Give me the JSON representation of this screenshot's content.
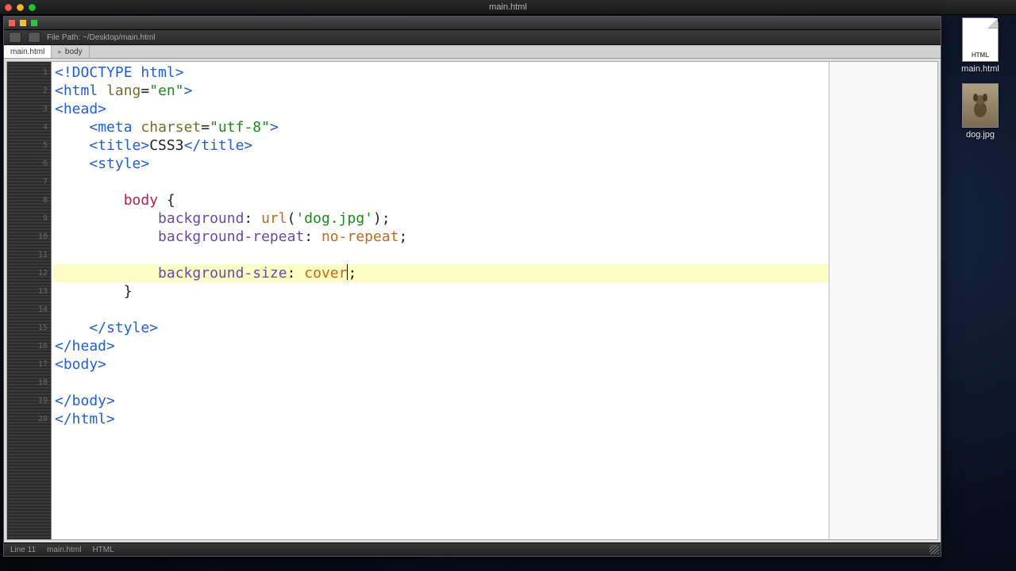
{
  "menubar": {
    "center_title": "main.html"
  },
  "desktop": {
    "file1": {
      "badge": "HTML",
      "label": "main.html"
    },
    "file2": {
      "label": "dog.jpg"
    }
  },
  "window": {
    "title_path": "File Path: ~/Desktop/main.html",
    "tab_label": "main.html",
    "breadcrumb": "body"
  },
  "statusbar": {
    "left": "Line 11",
    "mid": "main.html",
    "right": "HTML"
  },
  "code": {
    "lines": [
      {
        "indent": 0,
        "tokens": [
          {
            "cls": "tag",
            "t": "<!DOCTYPE html>"
          }
        ]
      },
      {
        "indent": 0,
        "tokens": [
          {
            "cls": "tag",
            "t": "<html "
          },
          {
            "cls": "attr",
            "t": "lang"
          },
          {
            "cls": "punc",
            "t": "="
          },
          {
            "cls": "str",
            "t": "\"en\""
          },
          {
            "cls": "tag",
            "t": ">"
          }
        ]
      },
      {
        "indent": 0,
        "tokens": [
          {
            "cls": "tag",
            "t": "<head>"
          }
        ]
      },
      {
        "indent": 1,
        "tokens": [
          {
            "cls": "tag",
            "t": "<meta "
          },
          {
            "cls": "attr",
            "t": "charset"
          },
          {
            "cls": "punc",
            "t": "="
          },
          {
            "cls": "str",
            "t": "\"utf-8\""
          },
          {
            "cls": "tag",
            "t": ">"
          }
        ]
      },
      {
        "indent": 1,
        "tokens": [
          {
            "cls": "tag",
            "t": "<title>"
          },
          {
            "cls": "punc",
            "t": "CSS3"
          },
          {
            "cls": "tag",
            "t": "</title>"
          }
        ]
      },
      {
        "indent": 1,
        "tokens": [
          {
            "cls": "tag",
            "t": "<style>"
          }
        ]
      },
      {
        "blank": true
      },
      {
        "indent": 2,
        "tokens": [
          {
            "cls": "sel",
            "t": "body"
          },
          {
            "cls": "punc",
            "t": " {"
          }
        ]
      },
      {
        "indent": 3,
        "tokens": [
          {
            "cls": "prop",
            "t": "background"
          },
          {
            "cls": "punc",
            "t": ": "
          },
          {
            "cls": "val",
            "t": "url"
          },
          {
            "cls": "punc",
            "t": "("
          },
          {
            "cls": "str",
            "t": "'dog.jpg'"
          },
          {
            "cls": "punc",
            "t": ");"
          }
        ]
      },
      {
        "indent": 3,
        "tokens": [
          {
            "cls": "prop",
            "t": "background-repeat"
          },
          {
            "cls": "punc",
            "t": ": "
          },
          {
            "cls": "val",
            "t": "no-repeat"
          },
          {
            "cls": "punc",
            "t": ";"
          }
        ]
      },
      {
        "blank": true
      },
      {
        "hl": true,
        "caret_after": 4,
        "indent": 3,
        "tokens": [
          {
            "cls": "prop",
            "t": "background-size"
          },
          {
            "cls": "punc",
            "t": ": "
          },
          {
            "cls": "val",
            "t": "cover"
          },
          {
            "cls": "punc",
            "t": ";"
          }
        ]
      },
      {
        "indent": 2,
        "tokens": [
          {
            "cls": "punc",
            "t": "}"
          }
        ]
      },
      {
        "blank": true
      },
      {
        "indent": 1,
        "tokens": [
          {
            "cls": "tag",
            "t": "</style>"
          }
        ]
      },
      {
        "indent": 0,
        "tokens": [
          {
            "cls": "tag",
            "t": "</head>"
          }
        ]
      },
      {
        "indent": 0,
        "tokens": [
          {
            "cls": "tag",
            "t": "<body>"
          }
        ]
      },
      {
        "blank": true
      },
      {
        "indent": 0,
        "tokens": [
          {
            "cls": "tag",
            "t": "</body>"
          }
        ]
      },
      {
        "indent": 0,
        "tokens": [
          {
            "cls": "tag",
            "t": "</html>"
          }
        ]
      }
    ]
  }
}
